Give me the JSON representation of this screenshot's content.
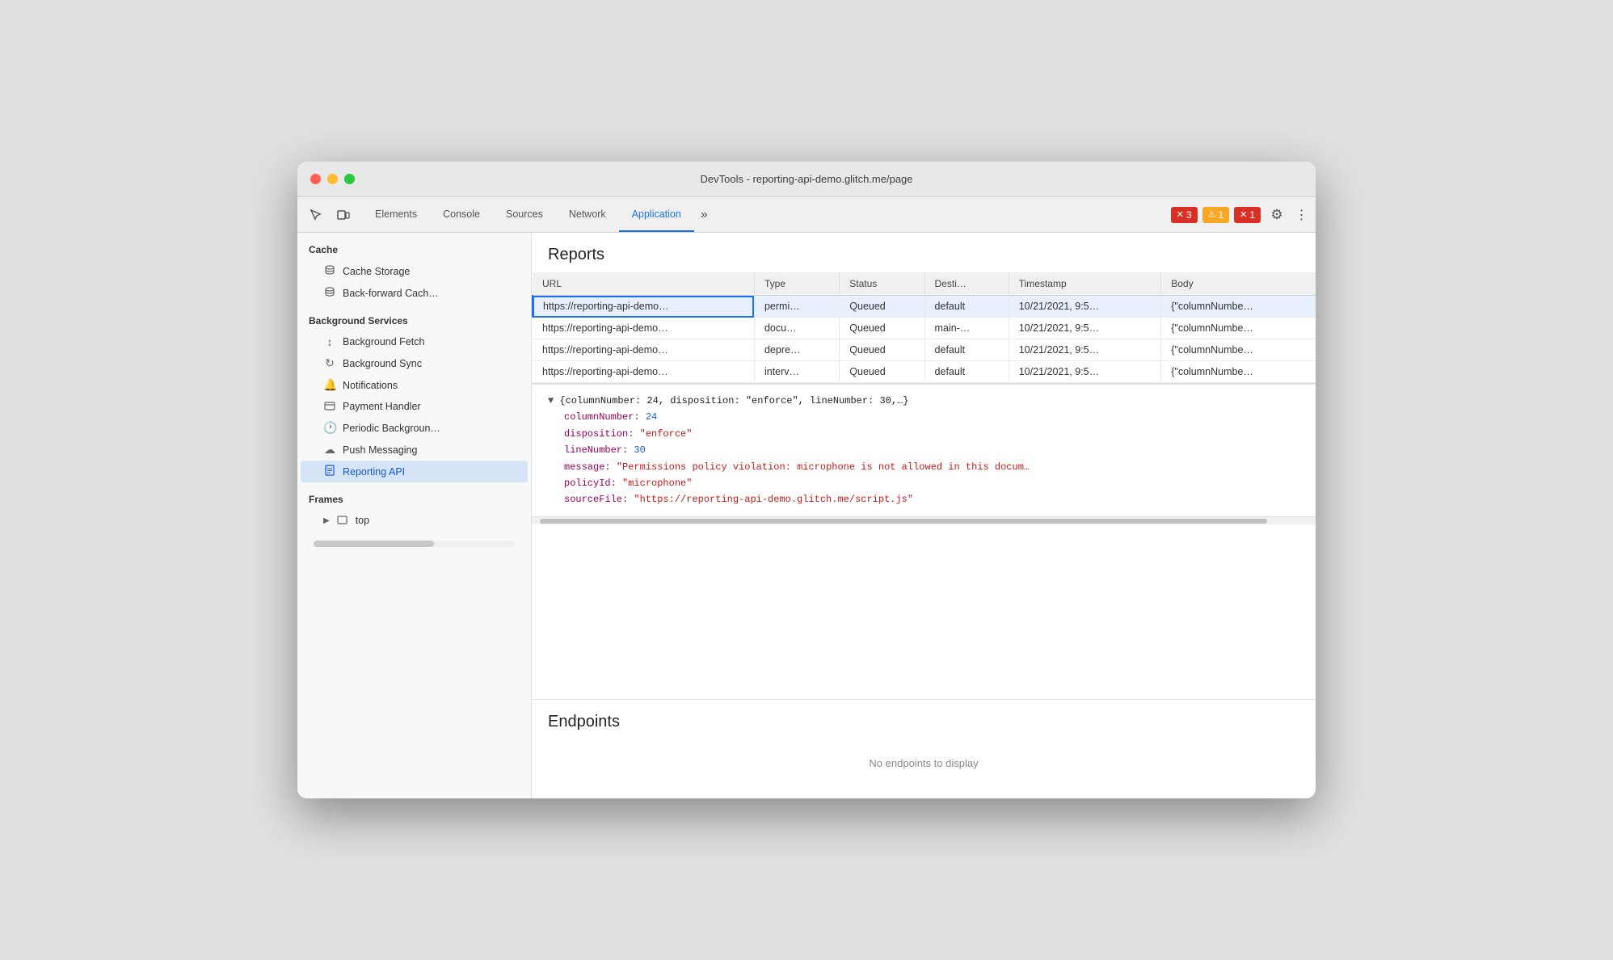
{
  "window": {
    "title": "DevTools - reporting-api-demo.glitch.me/page"
  },
  "toolbar": {
    "tabs": [
      {
        "id": "elements",
        "label": "Elements",
        "active": false
      },
      {
        "id": "console",
        "label": "Console",
        "active": false
      },
      {
        "id": "sources",
        "label": "Sources",
        "active": false
      },
      {
        "id": "network",
        "label": "Network",
        "active": false
      },
      {
        "id": "application",
        "label": "Application",
        "active": true
      }
    ],
    "more_tabs_icon": "»",
    "error_badges": [
      {
        "id": "errors",
        "icon": "✕",
        "count": "3",
        "color": "red"
      },
      {
        "id": "warnings",
        "icon": "⚠",
        "count": "1",
        "color": "yellow"
      },
      {
        "id": "errors2",
        "icon": "✕",
        "count": "1",
        "color": "red"
      }
    ],
    "gear_icon": "⚙",
    "dots_icon": "⋮"
  },
  "sidebar": {
    "cache_section": "Cache",
    "cache_items": [
      {
        "id": "cache-storage",
        "label": "Cache Storage",
        "icon": "🗄"
      },
      {
        "id": "back-forward",
        "label": "Back-forward Cach…",
        "icon": "🗄"
      }
    ],
    "background_services_section": "Background Services",
    "background_items": [
      {
        "id": "bg-fetch",
        "label": "Background Fetch",
        "icon": "↕"
      },
      {
        "id": "bg-sync",
        "label": "Background Sync",
        "icon": "↻"
      },
      {
        "id": "notifications",
        "label": "Notifications",
        "icon": "🔔"
      },
      {
        "id": "payment-handler",
        "label": "Payment Handler",
        "icon": "▭"
      },
      {
        "id": "periodic-bg",
        "label": "Periodic Backgroun…",
        "icon": "🕐"
      },
      {
        "id": "push-messaging",
        "label": "Push Messaging",
        "icon": "☁"
      },
      {
        "id": "reporting-api",
        "label": "Reporting API",
        "icon": "📄",
        "active": true
      }
    ],
    "frames_section": "Frames",
    "frame_items": [
      {
        "id": "top",
        "label": "top",
        "icon": "▭",
        "expand": true
      }
    ]
  },
  "reports": {
    "title": "Reports",
    "columns": [
      "URL",
      "Type",
      "Status",
      "Desti…",
      "Timestamp",
      "Body"
    ],
    "rows": [
      {
        "url": "https://reporting-api-demo…",
        "type": "permi…",
        "status": "Queued",
        "destination": "default",
        "timestamp": "10/21/2021, 9:5…",
        "body": "{\"columnNumbe…",
        "selected": true
      },
      {
        "url": "https://reporting-api-demo…",
        "type": "docu…",
        "status": "Queued",
        "destination": "main-…",
        "timestamp": "10/21/2021, 9:5…",
        "body": "{\"columnNumbe…",
        "selected": false
      },
      {
        "url": "https://reporting-api-demo…",
        "type": "depre…",
        "status": "Queued",
        "destination": "default",
        "timestamp": "10/21/2021, 9:5…",
        "body": "{\"columnNumbe…",
        "selected": false
      },
      {
        "url": "https://reporting-api-demo…",
        "type": "interv…",
        "status": "Queued",
        "destination": "default",
        "timestamp": "10/21/2021, 9:5…",
        "body": "{\"columnNumbe…",
        "selected": false
      }
    ]
  },
  "detail": {
    "header": "▼ {columnNumber: 24, disposition: \"enforce\", lineNumber: 30,…}",
    "properties": [
      {
        "key": "columnNumber",
        "value": "24",
        "type": "num"
      },
      {
        "key": "disposition",
        "value": "\"enforce\"",
        "type": "str"
      },
      {
        "key": "lineNumber",
        "value": "30",
        "type": "num"
      },
      {
        "key": "message",
        "value": "\"Permissions policy violation: microphone is not allowed in this docum…",
        "type": "str"
      },
      {
        "key": "policyId",
        "value": "\"microphone\"",
        "type": "str"
      },
      {
        "key": "sourceFile",
        "value": "\"https://reporting-api-demo.glitch.me/script.js\"",
        "type": "str"
      }
    ]
  },
  "endpoints": {
    "title": "Endpoints",
    "empty_message": "No endpoints to display"
  }
}
